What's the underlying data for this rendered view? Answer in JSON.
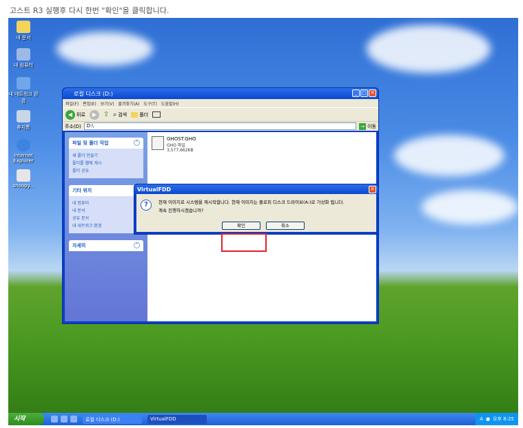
{
  "caption": "고스트 R3 실행후 다시 한번 \"확인\"을 클릭합니다.",
  "desktop_icons": [
    "내 문서",
    "내 컴퓨터",
    "내 네트워크 환경",
    "휴지통",
    "Internet Explorer",
    "snoopy..."
  ],
  "explorer": {
    "title": "로컬 디스크 (D:)",
    "menu": [
      "파일(F)",
      "편집(E)",
      "보기(V)",
      "즐겨찾기(A)",
      "도구(T)",
      "도움말(H)"
    ],
    "toolbar": {
      "back": "뒤로",
      "search": "검색",
      "folders": "폴더"
    },
    "address_label": "주소(D)",
    "address_value": "D:\\",
    "go_label": "이동",
    "tasks_title": "파일 및 폴더 작업",
    "tasks": [
      "새 폴더 만들기",
      "폴더를 웹에 게시",
      "폴더 공유"
    ],
    "places_title": "기타 위치",
    "places": [
      "내 컴퓨터",
      "내 문서",
      "공유 문서",
      "내 네트워크 환경"
    ],
    "details_title": "자세히",
    "file": {
      "name": "GHOST.GHO",
      "type": "GHO 파일",
      "size": "3,577,662KB"
    }
  },
  "dialog": {
    "title": "VirtualFDD",
    "line1": "현재 이미지로 시스템을 재시작합니다. 현재 이미지는 플로피 디스크 드라이브(A:)로 가상화 됩니다.",
    "line2": "계속 진행하시겠습니까?",
    "ok": "확인",
    "cancel": "취소"
  },
  "taskbar": {
    "start": "시작",
    "tasks": [
      "로컬 디스크 (D:)",
      "VirtualFDD"
    ],
    "tray_lang": "A",
    "clock": "오후 8:25"
  }
}
